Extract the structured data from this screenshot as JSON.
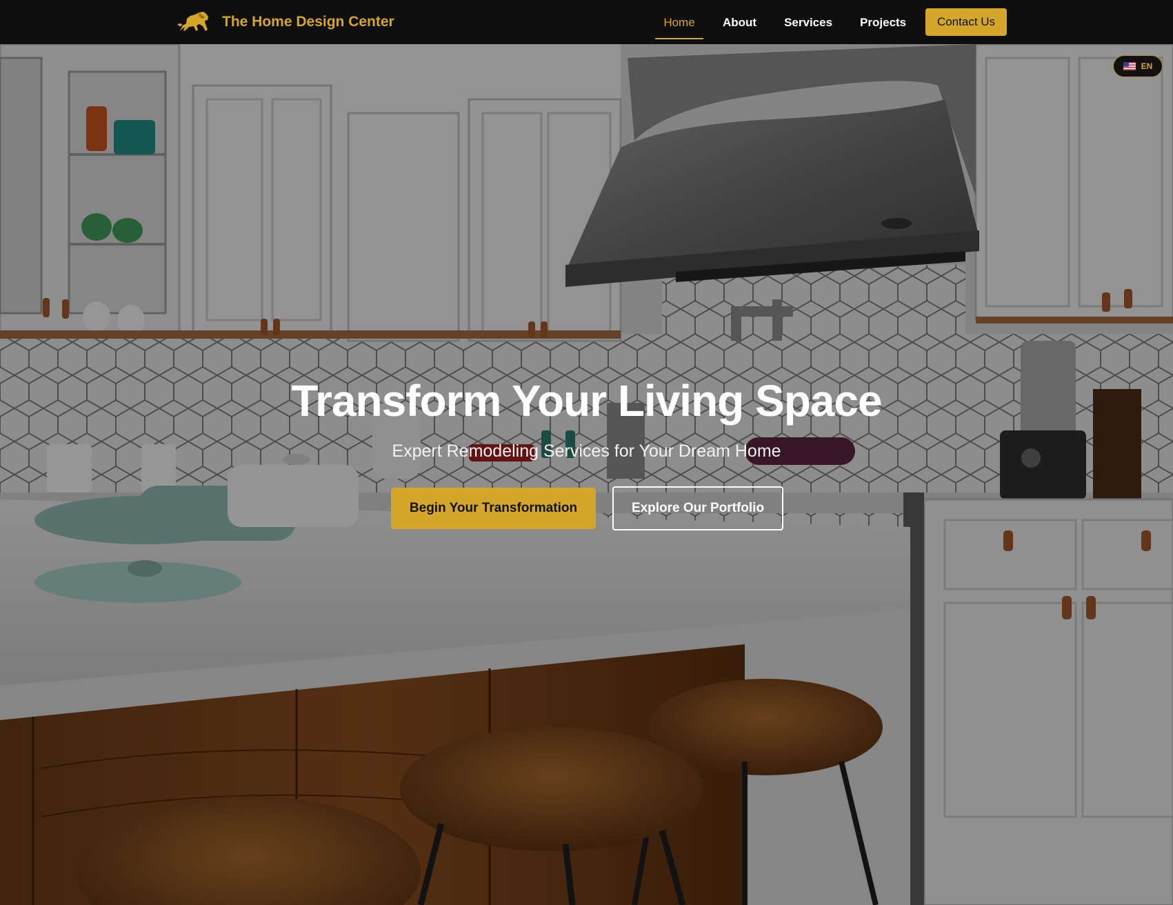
{
  "header": {
    "brand_name": "The Home Design Center",
    "logo_icon": "lion-icon",
    "nav": {
      "home": "Home",
      "about": "About",
      "services": "Services",
      "projects": "Projects"
    },
    "active_nav": "Home",
    "contact_label": "Contact Us"
  },
  "language": {
    "flag_icon": "us-flag-icon",
    "code": "EN"
  },
  "hero": {
    "title": "Transform Your Living Space",
    "subtitle": "Expert Remodeling Services for Your Dream Home",
    "primary_cta": "Begin Your Transformation",
    "secondary_cta": "Explore Our Portfolio"
  },
  "colors": {
    "brand_gold": "#d4a62a",
    "nav_background": "#0f0f0f",
    "text_light": "#ffffff"
  }
}
